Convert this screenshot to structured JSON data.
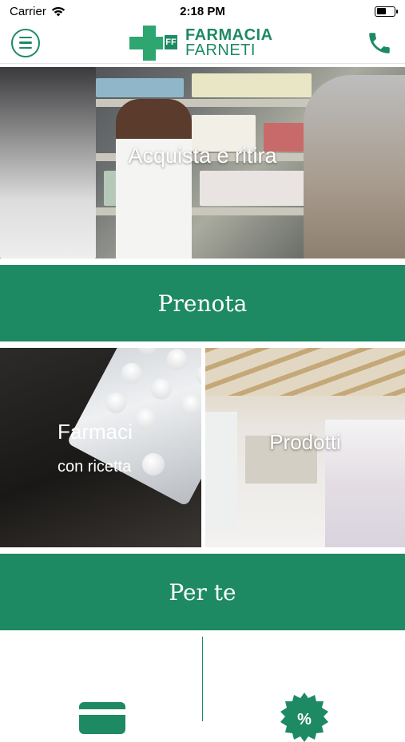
{
  "status_bar": {
    "carrier": "Carrier",
    "time": "2:18 PM",
    "icons": [
      "wifi-icon",
      "battery-icon"
    ]
  },
  "header": {
    "logo_badge": "FF",
    "logo_line1": "FARMACIA",
    "logo_line2": "FARNETI",
    "menu_icon": "hamburger-menu-icon",
    "call_icon": "phone-icon"
  },
  "sections": {
    "hero": {
      "label": "Acquista e ritira"
    },
    "prenota": {
      "label": "Prenota"
    },
    "farmaci": {
      "label": "Farmaci",
      "sublabel": "con ricetta"
    },
    "prodotti": {
      "label": "Prodotti"
    },
    "per_te": {
      "label": "Per te"
    }
  },
  "bottom_tiles": {
    "left_icon": "credit-card-icon",
    "right_icon": "discount-badge-icon",
    "right_icon_text": "%"
  },
  "colors": {
    "brand_green": "#1e8a63",
    "logo_green": "#2ea66f",
    "text_light": "#ffffff"
  }
}
